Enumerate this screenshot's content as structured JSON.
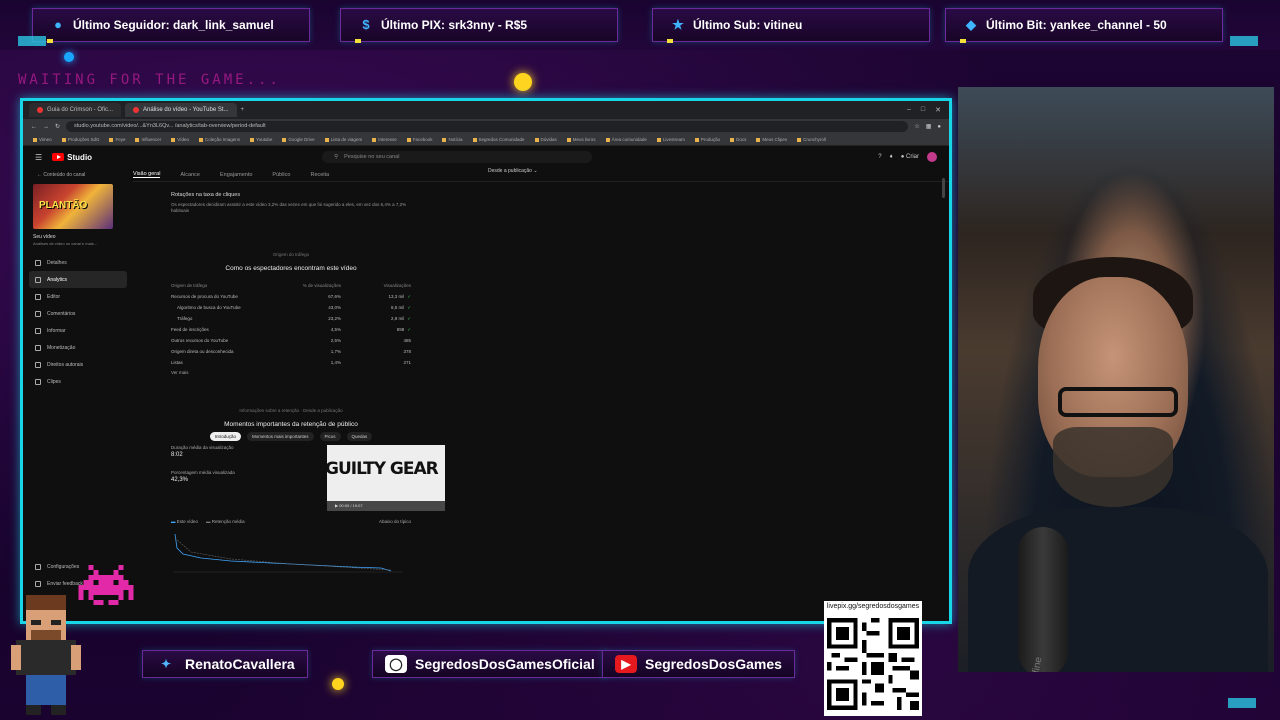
{
  "tickers": [
    {
      "label": "Último Seguidor: dark_link_samuel",
      "icon": "user-icon"
    },
    {
      "label": "Último PIX: srk3nny - R$5",
      "icon": "dollar-icon"
    },
    {
      "label": "Último Sub: vitineu",
      "icon": "star-icon"
    },
    {
      "label": "Último Bit: yankee_channel - 50",
      "icon": "gem-icon"
    }
  ],
  "waiting_text": "WAITING FOR THE GAME...",
  "browser": {
    "tabs": [
      {
        "label": "Guia do Crimson - Ofic..."
      },
      {
        "label": "Análise do vídeo - YouTube St..."
      }
    ],
    "url": "studio.youtube.com/video/...&Yn3L6Qv... /analytics/tab-overview/period-default",
    "bookmarks": [
      "Vimeo",
      "Produções SdG",
      "Feye",
      "Influencer",
      "Vídeo",
      "Coleção Imagens",
      "Youtube",
      "Google Drive",
      "Lista de viagem",
      "Interesse",
      "Facebook",
      "Notícia",
      "Segredos Comunidade",
      "Dúvidas",
      "Meus livros",
      "Área comunidade",
      "Livestream",
      "Produção",
      "Docs",
      "Meus Clipes",
      "Crunchyroll"
    ]
  },
  "studio": {
    "logo_text": "Studio",
    "search_placeholder": "Pesquise no seu canal",
    "create_label": "Criar",
    "back_label": "Conteúdo do canal",
    "thumb_text": "PLANTÃO",
    "video_title": "Seu vídeo",
    "video_subtitle": "Análises de vídeo no canal e mais...",
    "nav": [
      {
        "label": "Detalhes",
        "active": false
      },
      {
        "label": "Analytics",
        "active": true
      },
      {
        "label": "Editor",
        "active": false
      },
      {
        "label": "Comentários",
        "active": false
      },
      {
        "label": "Informar",
        "active": false
      },
      {
        "label": "Monetização",
        "active": false
      },
      {
        "label": "Direitos autorais",
        "active": false
      },
      {
        "label": "Clipes",
        "active": false
      }
    ],
    "settings_label": "Configurações",
    "feedback_label": "Enviar feedback",
    "subtabs": [
      "Visão geral",
      "Alcance",
      "Engajamento",
      "Público",
      "Receita"
    ],
    "publish_label": "Desde a publicação",
    "ctr_title": "Rotações na taxa de cliques",
    "ctr_text": "Os espectadores decidiram assistir a este vídeo 3,2% das vezes em que foi sugerido a eles, em vez dos 6,4% a 7,2% habituais",
    "discovery": {
      "caption": "Origem do tráfego",
      "title": "Como os espectadores encontram este vídeo",
      "headers": [
        "Origem de tráfego",
        "% de visualizações",
        "Visualizações"
      ],
      "rows": [
        {
          "source": "Recursos de procura do YouTube",
          "pct": "67,6%",
          "views": "13,3 mil"
        },
        {
          "source": "Algoritmo de busca do YouTube",
          "pct": "43,0%",
          "views": "8,5 mil"
        },
        {
          "source": "Tráfego",
          "pct": "23,2%",
          "views": "2,9 mil"
        },
        {
          "source": "Feed de inscrições",
          "pct": "4,5%",
          "views": "898"
        },
        {
          "source": "Outros recursos do YouTube",
          "pct": "2,5%",
          "views": "485"
        },
        {
          "source": "Origem direta ou desconhecida",
          "pct": "1,7%",
          "views": "378"
        },
        {
          "source": "Listas",
          "pct": "1,4%",
          "views": "271"
        }
      ],
      "more_label": "Ver mais"
    },
    "retention": {
      "caption": "Informações sobre a retenção · Desde a publicação",
      "title": "Momentos importantes da retenção de público",
      "pills": [
        "Introdução",
        "Momentos mais importantes",
        "Picos",
        "Quedas"
      ],
      "label_avg": "Duração média da visualização",
      "avg": "8:02",
      "label_pct": "Porcentagem média visualizada",
      "pct": "42,3%",
      "thumb_text": "GUILTY GEAR",
      "thumb_time": "00:00 / 19:07",
      "legend": [
        "Este vídeo",
        "Retenção média"
      ],
      "chart_note": "Abaixo do típico"
    }
  },
  "socials": [
    {
      "label": "RenatoCavallera",
      "icon": "twitter-icon"
    },
    {
      "label": "SegredosDosGamesOficial",
      "icon": "instagram-icon"
    },
    {
      "label": "SegredosDosGames",
      "icon": "youtube-icon"
    }
  ],
  "qr_label": "livepix.gg/segredosdosgames",
  "mic_brand": "fifine",
  "colors": {
    "accent": "#18d6e8",
    "ticker_border": "#6b2a9a",
    "alert_yellow": "#ffd41f",
    "waiting": "#b01d8e"
  }
}
